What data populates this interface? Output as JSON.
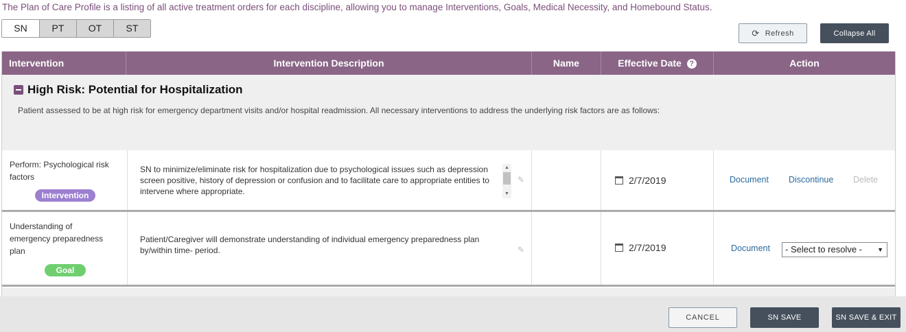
{
  "intro_text": "The Plan of Care Profile is a listing of all active treatment orders for each discipline, allowing you to manage Interventions, Goals, Medical Necessity, and Homebound Status.",
  "tabs": [
    {
      "label": "SN"
    },
    {
      "label": "PT"
    },
    {
      "label": "OT"
    },
    {
      "label": "ST"
    }
  ],
  "toolbar": {
    "refresh_label": "Refresh",
    "collapse_label": "Collapse All"
  },
  "columns": {
    "intervention": "Intervention",
    "description": "Intervention Description",
    "name": "Name",
    "effective_date": "Effective Date",
    "action": "Action"
  },
  "group": {
    "title": "High Risk: Potential for Hospitalization",
    "description": "Patient assessed to be at high risk for emergency department visits and/or hospital readmission. All necessary interventions to address the underlying risk factors are as follows:"
  },
  "rows": [
    {
      "name_line1": "Perform: Psychological risk",
      "name_line2": "factors",
      "badge": "Intervention",
      "description": "SN to minimize/eliminate risk for hospitalization due to psychological issues such as depression screen positive, history of depression or confusion and to facilitate care to appropriate entities to intervene where appropriate.",
      "date": "2/7/2019",
      "actions": [
        "Document",
        "Discontinue",
        "Delete"
      ]
    },
    {
      "name_line1": "Understanding of",
      "name_line2": "emergency preparedness",
      "name_line3": "plan",
      "badge": "Goal",
      "description": "Patient/Caregiver will demonstrate understanding of individual emergency preparedness plan by/within time- period.",
      "date": "2/7/2019",
      "action": "Document",
      "select_value": "- Select to resolve -"
    }
  ],
  "footer": {
    "cancel_label": "CANCEL",
    "save_label": "SN SAVE",
    "save_exit_label": "SN SAVE & EXIT"
  },
  "colors": {
    "header": "#8a6586",
    "accent_text": "#7a4f7a",
    "badge_intervention": "#9c7fd1",
    "badge_goal": "#6fcf6f",
    "dark_button": "#45505c"
  }
}
